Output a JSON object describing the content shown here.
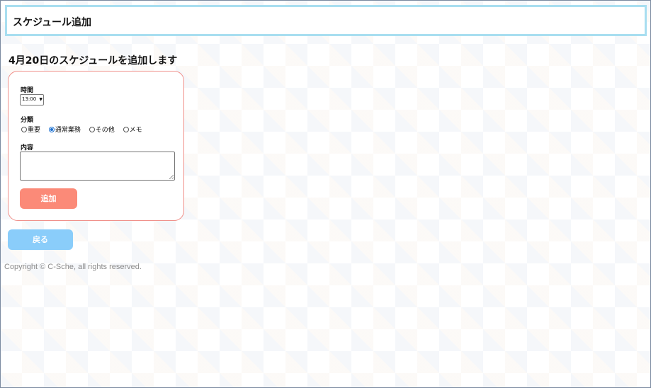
{
  "header": {
    "title": "スケジュール追加"
  },
  "page": {
    "heading": "4月20日のスケジュールを追加します"
  },
  "form": {
    "time_label": "時間",
    "time_value": "13:00",
    "category_label": "分類",
    "categories": [
      {
        "label": "重要",
        "checked": false
      },
      {
        "label": "通常業務",
        "checked": true
      },
      {
        "label": "その他",
        "checked": false
      },
      {
        "label": "メモ",
        "checked": false
      }
    ],
    "content_label": "内容",
    "content_value": "",
    "submit_label": "追加",
    "submit_color": "#fb8a78"
  },
  "back_button": {
    "label": "戻る",
    "color": "#8acdfa"
  },
  "footer": {
    "copyright": "Copyright © C-Sche, all rights reserved."
  }
}
